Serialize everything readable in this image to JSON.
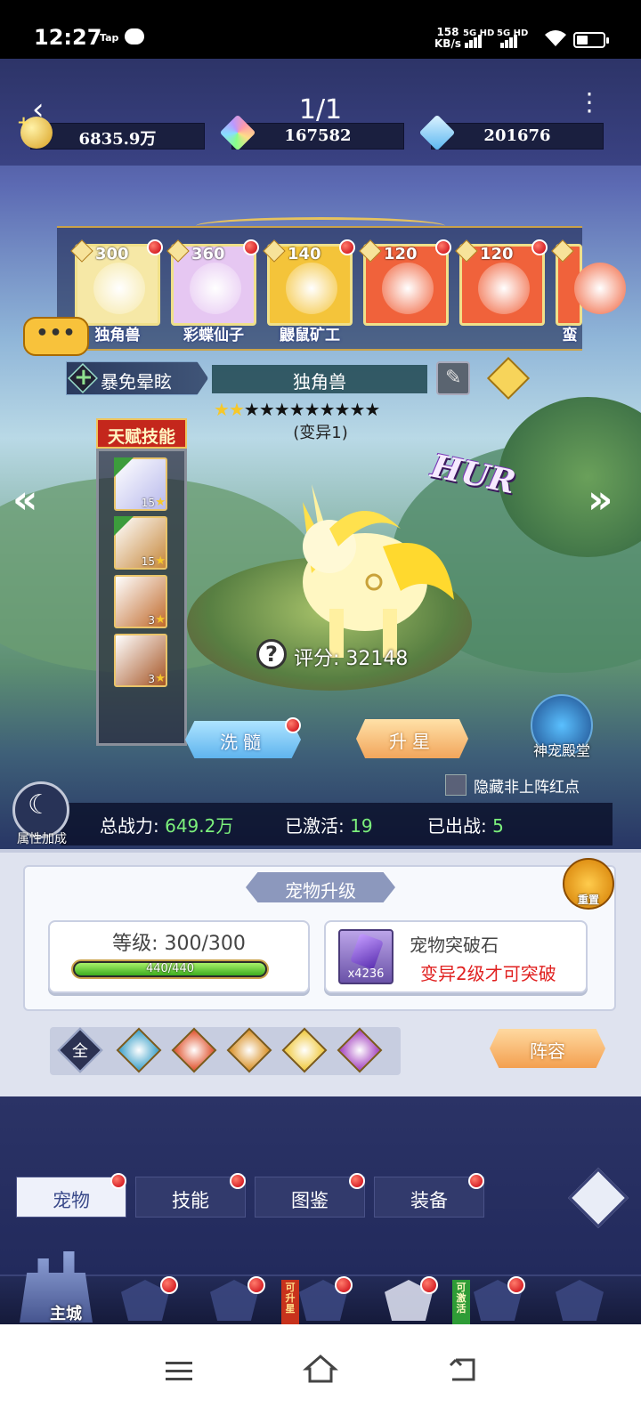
{
  "status_bar": {
    "time": "12:27",
    "app_badge": "Tap",
    "speed_value": "158",
    "speed_unit": "KB/s",
    "net1": "5G HD",
    "net2": "5G HD"
  },
  "header": {
    "page_indicator": "1/1",
    "resources": [
      {
        "icon": "gold-coin-icon",
        "value": "6835.9万"
      },
      {
        "icon": "rainbow-diamond-icon",
        "value": "167582"
      },
      {
        "icon": "blue-diamond-icon",
        "value": "201676"
      }
    ]
  },
  "carousel": {
    "pets": [
      {
        "name": "独角兽",
        "level": "300",
        "color": "#f6e8a6",
        "selected": true
      },
      {
        "name": "彩蝶仙子",
        "level": "360",
        "color": "#e6c7f2",
        "selected": false
      },
      {
        "name": "鼹鼠矿工",
        "level": "140",
        "color": "#f4c43a",
        "selected": false
      },
      {
        "name": "",
        "level": "120",
        "color": "#f0623b",
        "selected": false
      },
      {
        "name": "",
        "level": "120",
        "color": "#f0623b",
        "selected": false
      },
      {
        "name": "蛮",
        "level": "",
        "color": "#f0623b",
        "selected": false
      }
    ],
    "chat_text": "•••"
  },
  "pet_detail": {
    "trait": "暴免晕眩",
    "name": "独角兽",
    "stars_lit": 2,
    "stars_total": 11,
    "mutation": "(变异1)",
    "rarity": "HUR",
    "score": "评分: 32148"
  },
  "talent": {
    "title": "天赋技能",
    "skills": [
      {
        "level": "15",
        "color": "#b8b9ec",
        "tag": true
      },
      {
        "level": "15",
        "color": "#c6873b",
        "tag": true
      },
      {
        "level": "3",
        "color": "#c06a2c",
        "tag": false
      },
      {
        "level": "3",
        "color": "#a55424",
        "tag": false
      }
    ]
  },
  "actions": {
    "wash": "洗髓",
    "star_up": "升星",
    "shrine": "神宠殿堂",
    "hide_red_dots": "隐藏非上阵红点",
    "attr_bonus": "属性加成"
  },
  "stats": {
    "power_label": "总战力:",
    "power_value": "649.2万",
    "activated_label": "已激活:",
    "activated_value": "19",
    "deployed_label": "已出战:",
    "deployed_value": "5"
  },
  "upgrade": {
    "title": "宠物升级",
    "reset": "重置",
    "level_label": "等级: 300/300",
    "xp_text": "440/440",
    "xp_progress": 1.0,
    "stone_name": "宠物突破石",
    "stone_count": "x4236",
    "stone_note": "变异2级才可突破"
  },
  "filters": {
    "all": "全",
    "elements": [
      "wind-element-icon",
      "fire-element-icon",
      "earth-element-icon",
      "light-element-icon",
      "dark-element-icon"
    ],
    "colors": [
      "#3aa0c9",
      "#e0502a",
      "#d98f22",
      "#f0c83a",
      "#a23fbf"
    ]
  },
  "formation": "阵容",
  "tabs": [
    {
      "label": "宠物",
      "active": true
    },
    {
      "label": "技能",
      "active": false
    },
    {
      "label": "图鉴",
      "active": false
    },
    {
      "label": "装备",
      "active": false
    }
  ],
  "bottom_nav": {
    "home": "主城",
    "badge_upgrade": "可升星",
    "badge_activate": "可激活"
  }
}
